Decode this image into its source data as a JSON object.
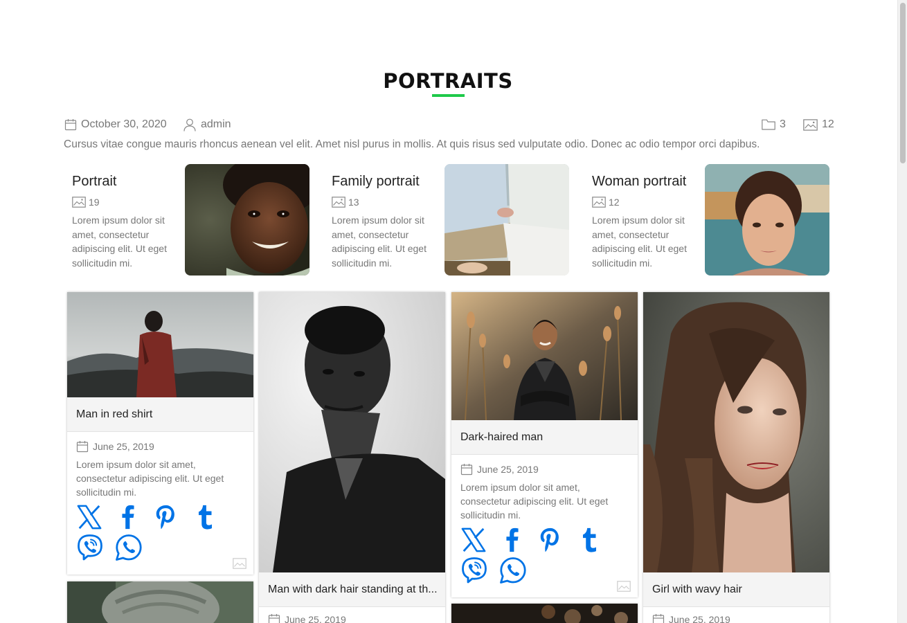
{
  "page": {
    "title": "PORTRAITS",
    "accent_color": "#1ec94a",
    "social_color": "#0073e6"
  },
  "meta": {
    "date": "October 30, 2020",
    "author": "admin",
    "folders_count": "3",
    "images_count": "12",
    "description": "Cursus vitae congue mauris rhoncus aenean vel elit. Amet nisl purus in mollis. At quis risus sed vulputate odio. Donec ac odio tempor orci dapibus."
  },
  "categories": [
    {
      "name": "Portrait",
      "count": "19",
      "description": "Lorem ipsum dolor sit amet, consectetur adipiscing elit. Ut eget sollicitudin mi."
    },
    {
      "name": "Family portrait",
      "count": "13",
      "description": "Lorem ipsum dolor sit amet, consectetur adipiscing elit. Ut eget sollicitudin mi."
    },
    {
      "name": "Woman portrait",
      "count": "12",
      "description": "Lorem ipsum dolor sit amet, consectetur adipiscing elit. Ut eget sollicitudin mi."
    }
  ],
  "cards": [
    {
      "title": "Man in red shirt",
      "date": "June 25, 2019",
      "description": "Lorem ipsum dolor sit amet, consectetur adipiscing elit. Ut eget sollicitudin mi."
    },
    {
      "title": "Man with dark hair standing at th...",
      "date": "June 25, 2019"
    },
    {
      "title": "Dark-haired man",
      "date": "June 25, 2019",
      "description": "Lorem ipsum dolor sit amet, consectetur adipiscing elit. Ut eget sollicitudin mi."
    },
    {
      "title": "Girl with wavy hair",
      "date": "June 25, 2019"
    }
  ],
  "social_icons": [
    "x-icon",
    "facebook-icon",
    "pinterest-icon",
    "tumblr-icon",
    "viber-icon",
    "whatsapp-icon"
  ]
}
